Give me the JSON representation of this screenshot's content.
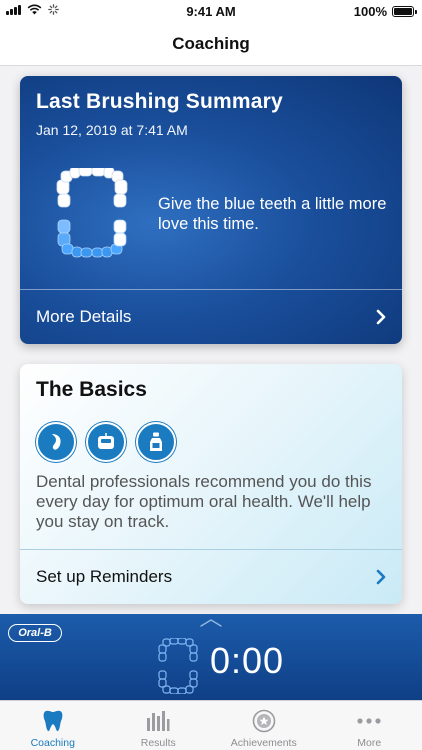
{
  "status_bar": {
    "time": "9:41 AM",
    "battery": "100%",
    "icons": [
      "signal-icon",
      "wifi-icon",
      "activity-spinner-icon",
      "battery-icon"
    ]
  },
  "nav": {
    "title": "Coaching"
  },
  "summary": {
    "title": "Last Brushing Summary",
    "date": "Jan 12, 2019 at 7:41 AM",
    "message": "Give the blue teeth a little more love this time.",
    "link_label": "More Details",
    "icons": [
      "teeth-diagram-icon",
      "chevron-right-icon"
    ]
  },
  "basics": {
    "title": "The Basics",
    "description": "Dental professionals recommend you do this every day for optimum oral health. We'll help you stay on track.",
    "link_label": "Set up Reminders",
    "icons": [
      "tongue-cleaning-icon",
      "floss-icon",
      "mouthwash-icon",
      "chevron-right-icon"
    ]
  },
  "timer": {
    "brand": "Oral-B",
    "value": "0:00",
    "icons": [
      "chevron-up-icon",
      "teeth-outline-icon"
    ]
  },
  "tabs": [
    {
      "label": "Coaching",
      "icon": "tooth-icon",
      "active": true
    },
    {
      "label": "Results",
      "icon": "bar-chart-icon",
      "active": false
    },
    {
      "label": "Achievements",
      "icon": "medal-icon",
      "active": false
    },
    {
      "label": "More",
      "icon": "more-dots-icon",
      "active": false
    }
  ],
  "colors": {
    "accent": "#1b7bc0",
    "summary_bg": "#1a4f9c",
    "timer_bg": "#0f3f86",
    "teeth_highlight": "#4aa6ff"
  }
}
